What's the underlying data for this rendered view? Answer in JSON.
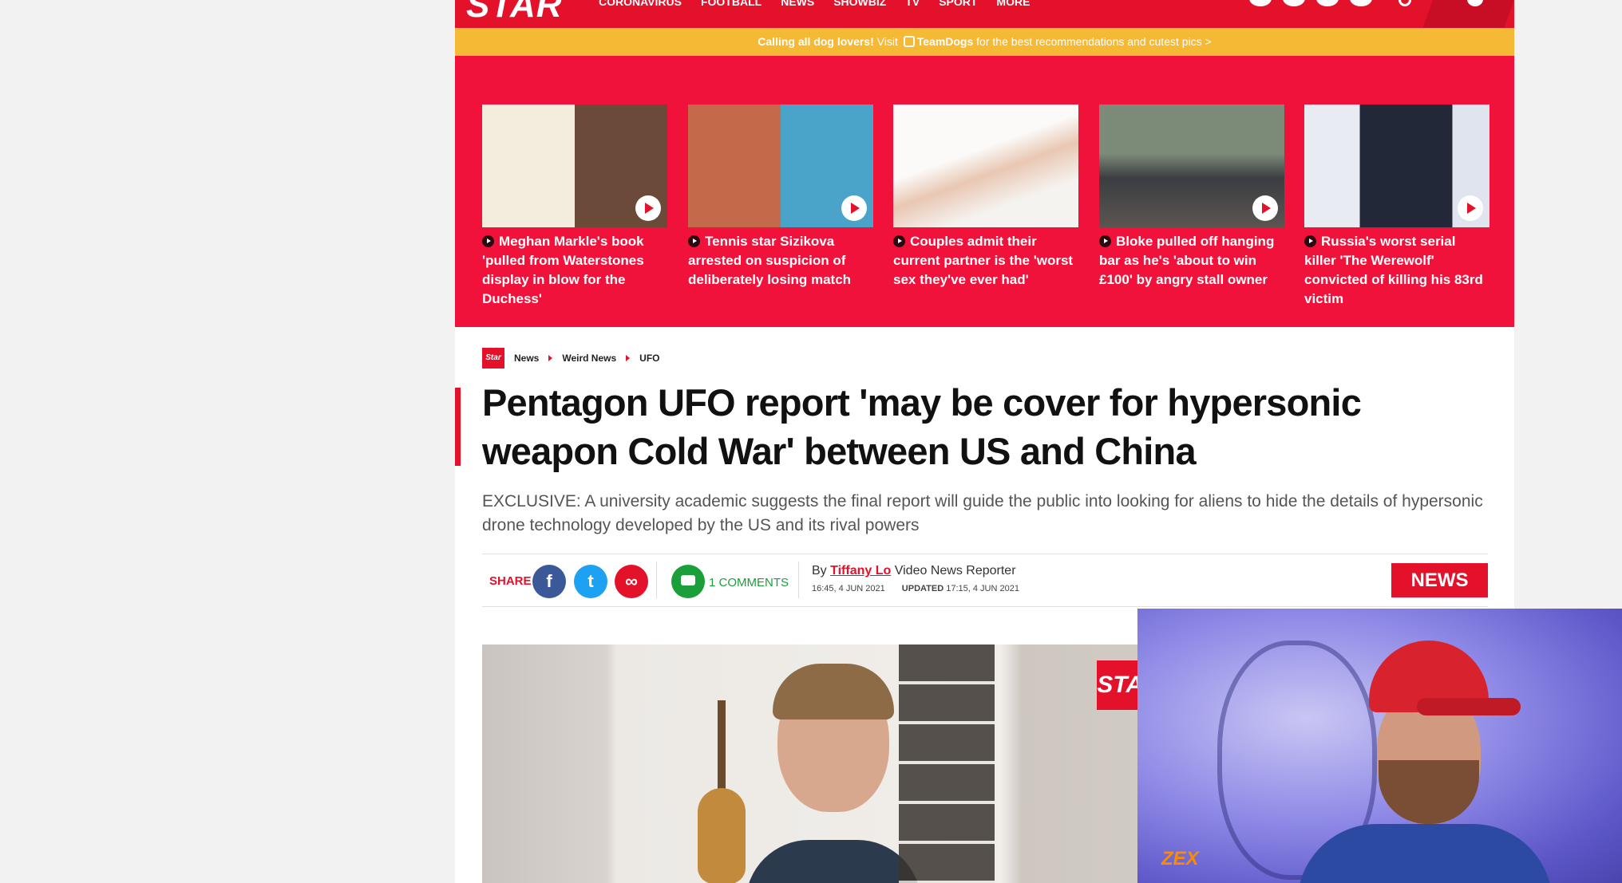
{
  "nav": {
    "logo": "STAR",
    "links": [
      "CORONAVIRUS",
      "FOOTBALL",
      "NEWS",
      "SHOWBIZ",
      "TV",
      "SPORT",
      "MORE"
    ]
  },
  "promo": {
    "lead": "Calling all dog lovers!",
    "visit": "Visit",
    "brand": "TeamDogs",
    "tail": "for the best recommendations and cutest pics >"
  },
  "stories": [
    {
      "caption": "Meghan Markle's book 'pulled from Waterstones display in blow for the Duchess'"
    },
    {
      "caption": "Tennis star Sizikova arrested on suspicion of deliberately losing match"
    },
    {
      "caption": "Couples admit their current partner is the 'worst sex they've ever had'"
    },
    {
      "caption": "Bloke pulled off hanging bar as he's 'about to win £100' by angry stall owner"
    },
    {
      "caption": "Russia's worst serial killer 'The Werewolf' convicted of killing his 83rd victim"
    }
  ],
  "breadcrumb": {
    "logo": "Star",
    "items": [
      "News",
      "Weird News",
      "UFO"
    ]
  },
  "article": {
    "headline": "Pentagon UFO report 'may be cover for hypersonic weapon Cold War' between US and China",
    "standfirst": "EXCLUSIVE: A university academic suggests the final report will guide the public into looking for aliens to hide the details of hypersonic drone technology developed by the US and its rival powers",
    "share_label": "SHARE",
    "comments": "1 COMMENTS",
    "by": "By",
    "author": "Tiffany Lo",
    "role": "Video News Reporter",
    "published": "16:45, 4 JUN 2021",
    "updated_label": "UPDATED",
    "updated": "17:15, 4 JUN 2021",
    "section_badge": "NEWS"
  },
  "video": {
    "logo": "STAR"
  },
  "webcam": {
    "tag": "ZEX"
  }
}
